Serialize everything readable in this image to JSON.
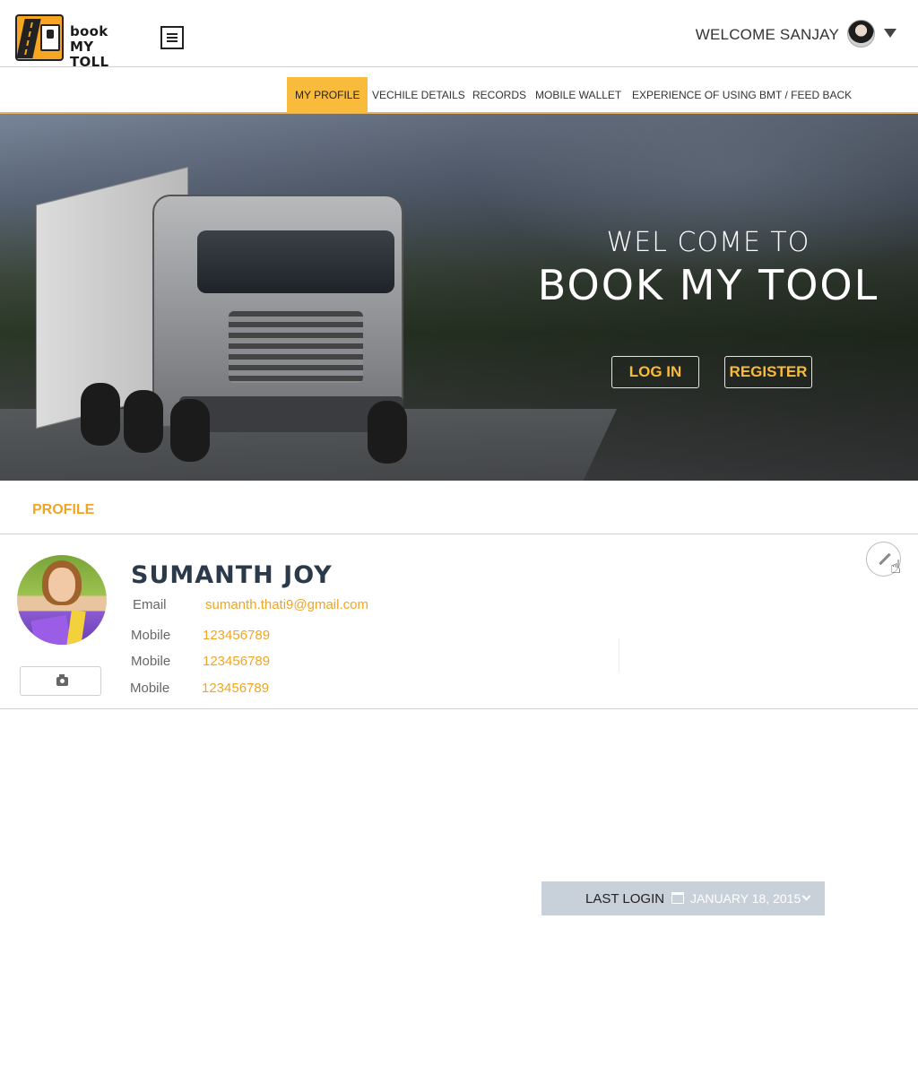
{
  "brand": {
    "line1": "book",
    "line2": "MY TOLL",
    "accent": "#f8bb3c"
  },
  "header": {
    "welcome": "WELCOME SANJAY",
    "menu_icon": "hamburger-icon",
    "caret_icon": "caret-down-icon"
  },
  "nav": {
    "items": [
      {
        "label": "MY PROFILE",
        "active": true
      },
      {
        "label": "VECHILE DETAILS",
        "active": false
      },
      {
        "label": "RECORDS",
        "active": false
      },
      {
        "label": "MOBILE WALLET",
        "active": false
      },
      {
        "label": "EXPERIENCE OF USING BMT / FEED BACK",
        "active": false
      }
    ]
  },
  "hero": {
    "subtitle": "WEL COME TO",
    "title": "BOOK MY TOOL",
    "login_label": "LOG IN",
    "register_label": "REGISTER"
  },
  "profile": {
    "heading": "PROFILE",
    "name": "SUMANTH JOY",
    "email_label": "Email",
    "email": "sumanth.thati9@gmail.com",
    "mobiles": [
      {
        "label": "Mobile",
        "value": "123456789"
      },
      {
        "label": "Mobile",
        "value": "123456789"
      },
      {
        "label": "Mobile",
        "value": "123456789"
      }
    ],
    "camera_icon": "camera-icon",
    "edit_icon": "pencil-icon"
  },
  "last_login": {
    "label": "LAST LOGIN",
    "date": "JANUARY 18, 2015",
    "icon": "calendar-icon"
  }
}
